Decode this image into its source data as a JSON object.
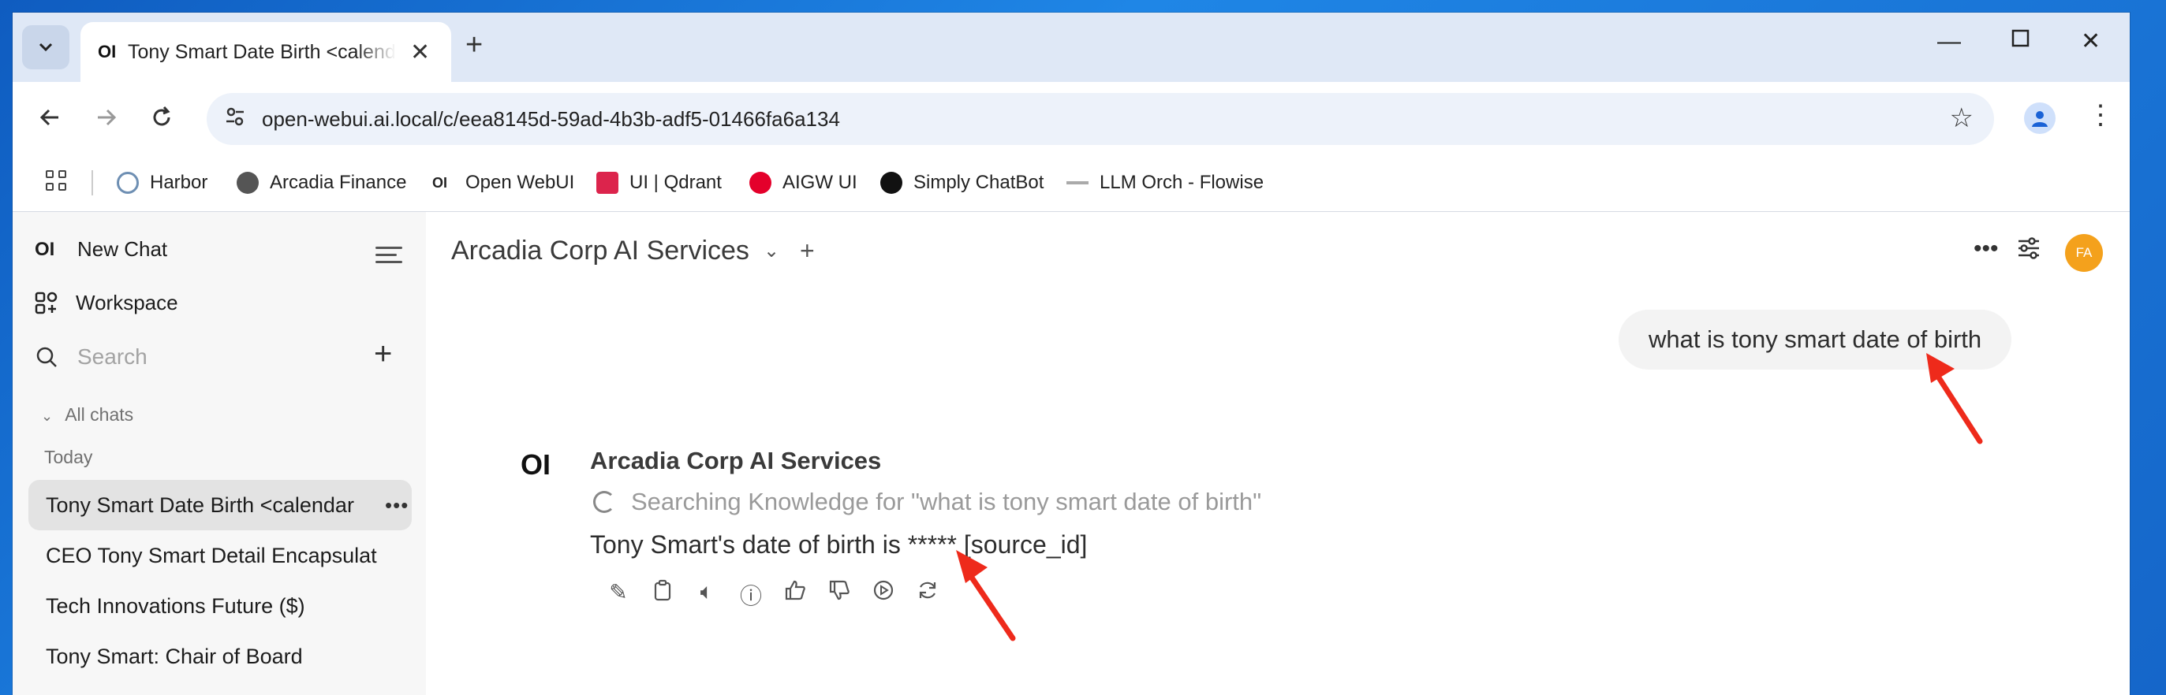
{
  "browser": {
    "tab_title": "Tony Smart Date Birth <calendar",
    "tab_favicon": "OI",
    "url": "open-webui.ai.local/c/eea8145d-59ad-4b3b-adf5-01466fa6a134",
    "bookmarks": [
      {
        "label": "Harbor",
        "icon": "harbor-icon",
        "color": "#6e8fb3"
      },
      {
        "label": "Arcadia Finance",
        "icon": "globe-icon",
        "color": "#444444"
      },
      {
        "label": "Open WebUI",
        "icon": "openwebui-icon",
        "color": "#111111"
      },
      {
        "label": "UI | Qdrant",
        "icon": "qdrant-icon",
        "color": "#dc244c"
      },
      {
        "label": "AIGW UI",
        "icon": "f5-icon",
        "color": "#e4002b"
      },
      {
        "label": "Simply ChatBot",
        "icon": "crown-icon",
        "color": "#111111"
      },
      {
        "label": "LLM Orch - Flowise",
        "icon": "flowise-icon",
        "color": "#999999"
      }
    ]
  },
  "sidebar": {
    "logo": "OI",
    "new_chat": "New Chat",
    "workspace": "Workspace",
    "search_placeholder": "Search",
    "group_label": "All chats",
    "section_today": "Today",
    "chats": [
      {
        "title": "Tony Smart Date Birth <calendar",
        "active": true
      },
      {
        "title": "CEO Tony Smart Detail Encapsulation",
        "active": false
      },
      {
        "title": "Tech Innovations Future ($)",
        "active": false
      },
      {
        "title": "Tony Smart: Chair of Board",
        "active": false
      }
    ]
  },
  "header": {
    "model_name": "Arcadia Corp AI Services",
    "avatar_initials": "FA",
    "avatar_color": "#f4a11c"
  },
  "conversation": {
    "user_message": "what is tony smart date of birth",
    "assistant_logo": "OI",
    "assistant_name": "Arcadia Corp AI Services",
    "status": "Searching Knowledge for \"what is tony smart date of birth\"",
    "answer": "Tony Smart's date of birth is ***** [source_id]"
  },
  "annotations": {
    "arrow_color": "#ee2a1b"
  }
}
